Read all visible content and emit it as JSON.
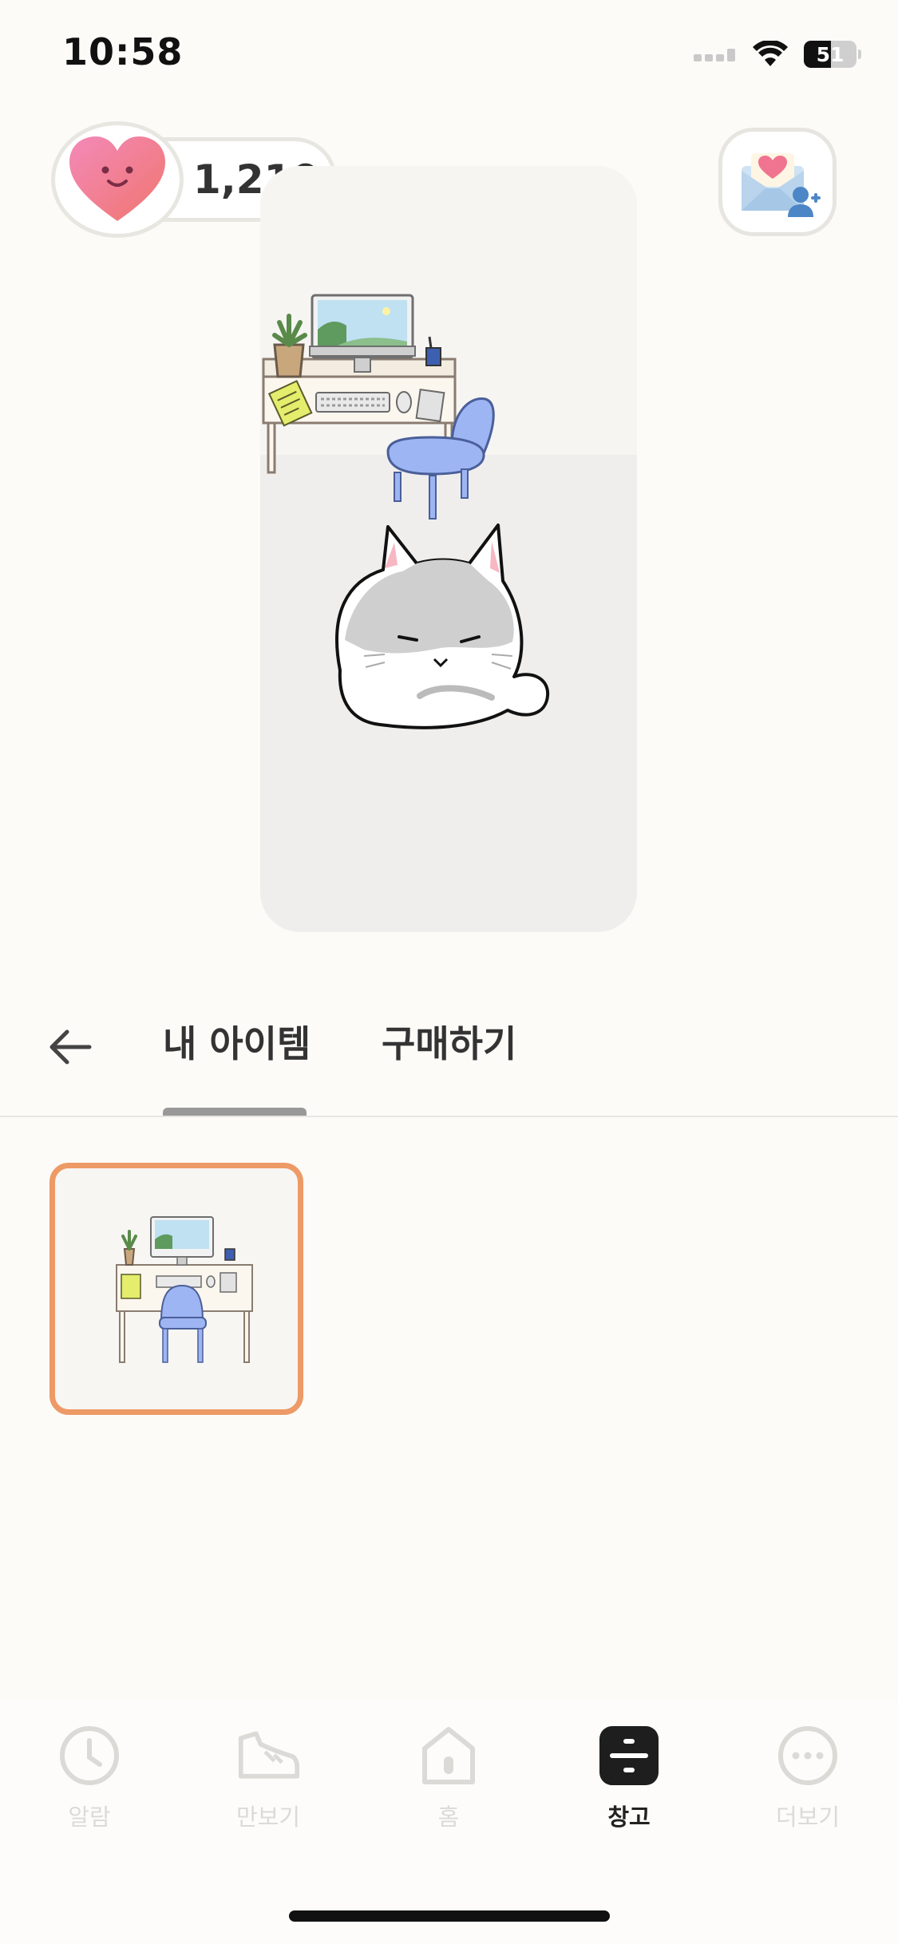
{
  "status_bar": {
    "time": "10:58",
    "battery_level": "51",
    "icons": [
      "signal-icon",
      "wifi-icon",
      "battery-icon"
    ]
  },
  "currency": {
    "amount": "1,210",
    "icon": "heart-face-icon"
  },
  "invite": {
    "icon": "letter-add-friend-icon"
  },
  "room": {
    "items": [
      "desk-icon",
      "monitor-icon",
      "plant-icon",
      "keyboard-icon",
      "chair-icon",
      "cat-icon"
    ]
  },
  "tabs": {
    "items": [
      {
        "label": "내 아이템",
        "active": true
      },
      {
        "label": "구매하기",
        "active": false
      }
    ]
  },
  "inventory": {
    "items": [
      {
        "icon": "desk-set-icon",
        "selected": true
      }
    ]
  },
  "bottom_nav": {
    "items": [
      {
        "label": "알람",
        "icon": "clock-icon",
        "active": false
      },
      {
        "label": "만보기",
        "icon": "shoe-icon",
        "active": false
      },
      {
        "label": "홈",
        "icon": "home-icon",
        "active": false
      },
      {
        "label": "창고",
        "icon": "storage-icon",
        "active": true
      },
      {
        "label": "더보기",
        "icon": "more-icon",
        "active": false
      }
    ]
  },
  "colors": {
    "background": "#fcfbf8",
    "accent_selected_border": "#ed9a66",
    "heart_pink": "#ef7aa0",
    "chair_blue": "#9db5f2",
    "nav_inactive": "#dcdad6"
  }
}
